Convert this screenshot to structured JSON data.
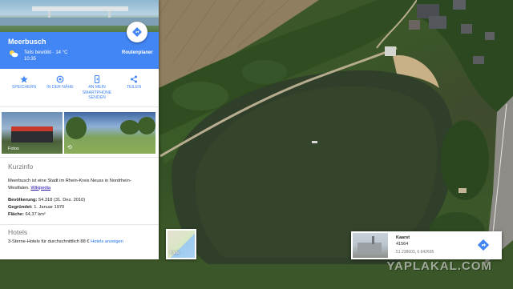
{
  "panel": {
    "title": "Meerbusch",
    "weather": {
      "condition": "Teils bewölkt · 14 °C",
      "time": "10:35",
      "icon": "partly-cloudy-icon"
    },
    "route_label": "Routenplaner",
    "actions": [
      {
        "label": "SPEICHERN",
        "icon": "star-icon"
      },
      {
        "label": "IN DER NÄHE",
        "icon": "nearby-icon"
      },
      {
        "label_lines": [
          "AN MEIN",
          "SMARTPHONE",
          "SENDEN"
        ],
        "icon": "phone-send-icon"
      },
      {
        "label": "TEILEN",
        "icon": "share-icon"
      }
    ],
    "photos": {
      "label": "Fotos",
      "panorama_icon": "360-icon"
    },
    "info": {
      "heading": "Kurzinfo",
      "description": "Meerbusch ist eine Stadt im Rhein-Kreis Neuss in Nordrhein-Westfalen.",
      "source_link": "Wikipedia",
      "facts": [
        {
          "label": "Bevölkerung:",
          "value": "54.318 (31. Dez. 2010)"
        },
        {
          "label": "Gegründet:",
          "value": "1. Januar 1970"
        },
        {
          "label": "Fläche:",
          "value": "64,37 km²"
        }
      ]
    },
    "hotels": {
      "heading": "Hotels",
      "text": "3-Sterne-Hotels für durchschnittlich 88 €",
      "link": "Hotels anzeigen"
    }
  },
  "layer_toggle": {
    "label": "Karte"
  },
  "place_card": {
    "title": "Kaarst",
    "zip": "41564",
    "coords": "51.238603, 6.642695"
  },
  "watermark": "YAPLAKAL.COM",
  "colors": {
    "accent": "#4285f4",
    "link": "#1a0dab"
  }
}
